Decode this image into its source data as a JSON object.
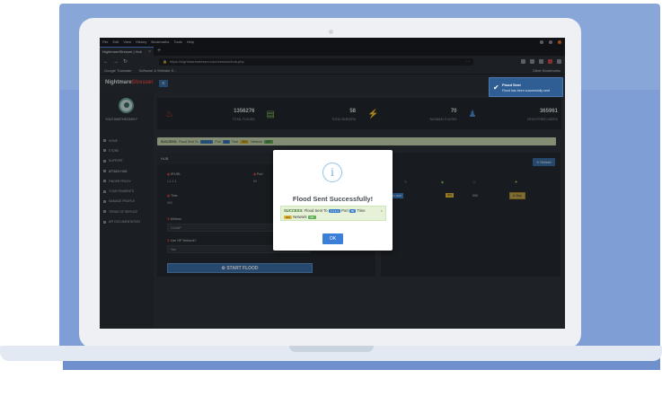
{
  "browser": {
    "menu": [
      "File",
      "Edit",
      "View",
      "History",
      "Bookmarks",
      "Tools",
      "Help"
    ],
    "tab_title": "NightmareStresser | Hub",
    "url": "https://nightmarestresser.com/session/hub.php",
    "bookmarks": [
      "Google Translate",
      "Software & Website D..."
    ],
    "other_bookmarks": "Other Bookmarks"
  },
  "brand": {
    "name": "Nightmare",
    "accent": "Stresser"
  },
  "sidebar": {
    "username": "YOUTUBETHEGEEKY",
    "items": [
      "HOME",
      "STORE",
      "SUPPORT",
      "ATTACK HUB",
      "FINDER PROXY",
      "YOUR PAYMENTS",
      "MANAGE PROFILE",
      "TERMS OF SERVICE",
      "API DOCUMENTATION"
    ]
  },
  "stats": [
    {
      "value": "1356276",
      "label": "TOTAL FLOODS",
      "icon": "fire-icon"
    },
    {
      "value": "58",
      "label": "TOTAL SERVERS",
      "icon": "server-icon"
    },
    {
      "value": "70",
      "label": "RUNNING FLOODS",
      "icon": "bolt-icon"
    },
    {
      "value": "365961",
      "label": "REGISTERED USERS",
      "icon": "users-icon"
    }
  ],
  "alert": {
    "prefix": "SUCCESS:",
    "text1": "Flood Sent To",
    "ip": "1.1.1.1",
    "text2": "Port",
    "port": "80",
    "text3": "Time",
    "time": "300",
    "text4": "Network",
    "net": "VIP"
  },
  "hub": {
    "title": "HUB",
    "ip_label": "IP/URL",
    "ip_value": "1.1.1.1",
    "port_label": "Port",
    "port_value": "80",
    "time_label": "Time",
    "time_value": "300",
    "method_label": "Method",
    "method_value": "CLDAP",
    "vip_label": "Use VIP Network?",
    "vip_value": "Yes",
    "start_button": "START FLOOD"
  },
  "right_panel": {
    "refresh": "Refresh",
    "row_target": "1.1.1.1",
    "row_method": "CLDAP",
    "row_time": "300",
    "row_left": "595",
    "stop": "Stop"
  },
  "modal": {
    "icon": "i",
    "title": "Flood Sent Successfully!",
    "msg_prefix": "SUCCESS:",
    "msg_text1": "Flood Sent To",
    "msg_ip": "1.1.1.1",
    "msg_text2": "Port",
    "msg_port": "80",
    "msg_text3": "Time",
    "msg_time": "300",
    "msg_text4": "Network",
    "msg_net": "VIP",
    "ok": "OK"
  },
  "toast": {
    "title": "Flood Sent",
    "message": "Flood has been successfully sent"
  }
}
